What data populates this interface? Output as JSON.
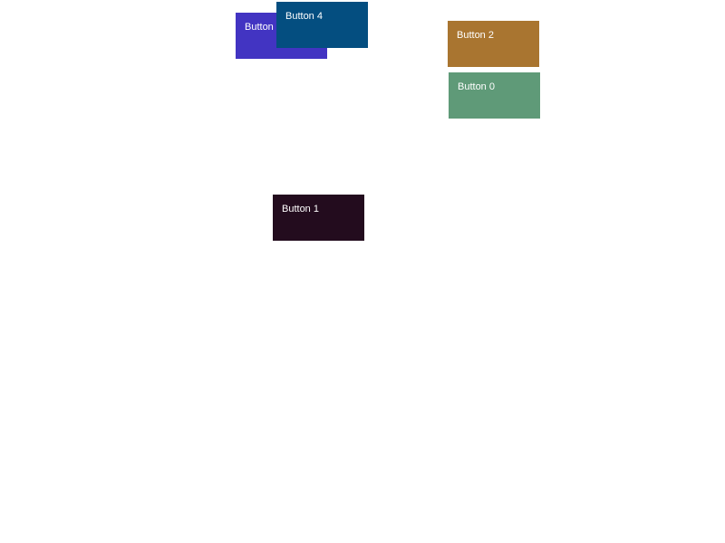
{
  "buttons": {
    "button_0": {
      "label": "Button 0",
      "color": "#5f9a78"
    },
    "button_1": {
      "label": "Button 1",
      "color": "#230c1e"
    },
    "button_2": {
      "label": "Button 2",
      "color": "#a97530"
    },
    "button_3": {
      "label": "Button 3",
      "color": "#4234c2"
    },
    "button_4": {
      "label": "Button 4",
      "color": "#044e80"
    }
  }
}
